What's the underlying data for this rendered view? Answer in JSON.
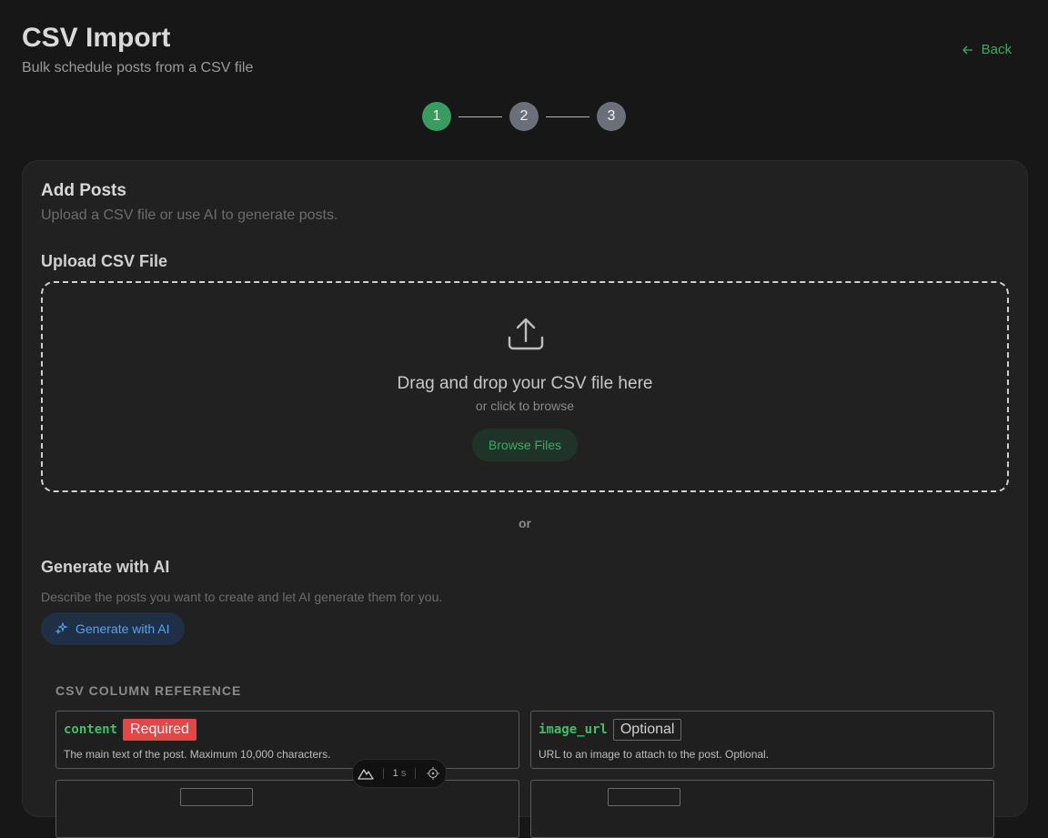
{
  "header": {
    "title": "CSV Import",
    "subtitle": "Bulk schedule posts from a CSV file",
    "back_label": "Back"
  },
  "stepper": {
    "steps": [
      "1",
      "2",
      "3"
    ],
    "active_step": 1
  },
  "card": {
    "title": "Add Posts",
    "description": "Upload a CSV file or use AI to generate posts.",
    "upload": {
      "title": "Upload CSV File",
      "drop_title": "Drag and drop your CSV file here",
      "drop_sub": "or click to browse",
      "browse_label": "Browse Files"
    },
    "or_label": "or",
    "ai": {
      "title": "Generate with AI",
      "description": "Describe the posts you want to create and let AI generate them for you.",
      "button_label": "Generate with AI"
    },
    "reference": {
      "title": "CSV COLUMN REFERENCE",
      "columns": [
        {
          "name": "content",
          "badge": "Required",
          "description": "The main text of the post. Maximum 10,000 characters."
        },
        {
          "name": "image_url",
          "badge": "Optional",
          "description": "URL to an image to attach to the post. Optional."
        }
      ]
    }
  },
  "devbar": {
    "time_value": "1",
    "time_unit": "s"
  },
  "colors": {
    "accent": "#3a9a60",
    "required": "#e04848",
    "ai_blue": "#5aa2ee"
  }
}
